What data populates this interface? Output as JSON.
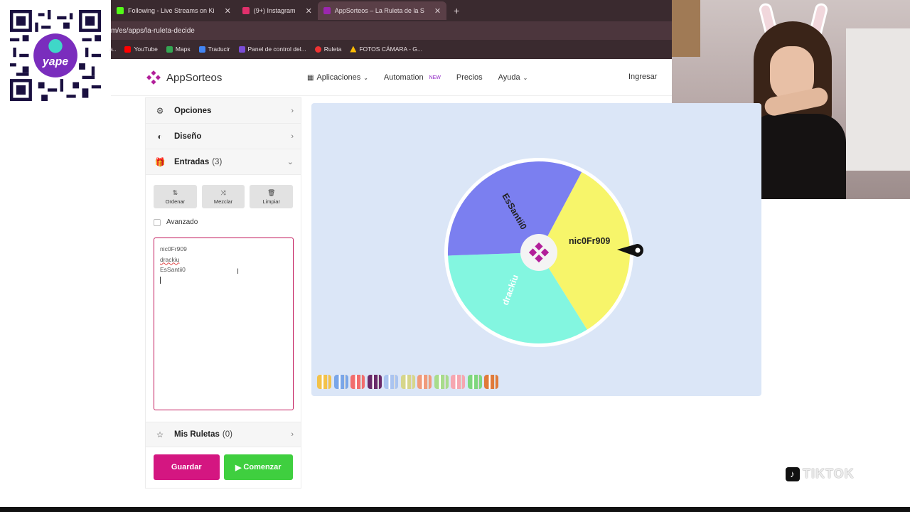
{
  "browser": {
    "tabs": [
      {
        "label": "Following - Live Streams on Ki",
        "color": "#53fc18",
        "active": false
      },
      {
        "label": "(9+) Instagram",
        "color": "#e1306c",
        "active": false
      },
      {
        "label": "AppSorteos – La Ruleta de la S",
        "color": "#9c27b0",
        "active": true
      }
    ],
    "new_tab": "+",
    "url": "m/es/apps/la-ruleta-decide",
    "bookmarks": [
      {
        "label": "",
        "color": "#666"
      },
      {
        "label": "YouTube",
        "color": "#ff0000"
      },
      {
        "label": "Maps",
        "color": "#34a853"
      },
      {
        "label": "Traducir",
        "color": "#4285f4"
      },
      {
        "label": "Panel de control del...",
        "color": "#7b4dd6"
      },
      {
        "label": "Ruleta",
        "color": "#e33"
      },
      {
        "label": "FOTOS CÁMARA - G...",
        "color": "#fbbc04"
      }
    ]
  },
  "header": {
    "brand": "AppSorteos",
    "nav": [
      {
        "label": "Aplicaciones",
        "icon": "grid-icon",
        "dropdown": true
      },
      {
        "label": "Automation",
        "badge": "NEW"
      },
      {
        "label": "Precios"
      },
      {
        "label": "Ayuda",
        "dropdown": true
      }
    ],
    "login": "Ingresar"
  },
  "panel": {
    "options": {
      "label": "Opciones"
    },
    "design": {
      "label": "Diseño"
    },
    "entries": {
      "label": "Entradas",
      "count": "(3)"
    },
    "tools": [
      {
        "label": "Ordenar",
        "glyph": "⇅"
      },
      {
        "label": "Mezclar",
        "glyph": "⤨"
      },
      {
        "label": "Limpiar",
        "glyph": "🗑"
      }
    ],
    "advanced": "Avanzado",
    "entry_lines": [
      "nic0Fr909",
      "drackiu",
      "EsSantii0"
    ],
    "my_wheels": {
      "label": "Mis Ruletas",
      "count": "(0)"
    },
    "save_label": "Guardar",
    "start_label": "Comenzar"
  },
  "wheel": {
    "segments": [
      {
        "label": "EsSantii0",
        "color": "#f7f56a"
      },
      {
        "label": "nic0Fr909",
        "color": "#83f6e0"
      },
      {
        "label": "drackiu",
        "color": "#7b7ff0"
      }
    ],
    "pointer_label": "nic0Fr909",
    "palette": [
      "#f3c24a",
      "#7aa6e8",
      "#f26d6d",
      "#6a2a6a",
      "#aac4f0",
      "#d6d68a",
      "#f09a7a",
      "#a8dc8c",
      "#f6a6b0",
      "#7ed77e",
      "#e07a3a"
    ]
  },
  "watermark": {
    "tiktok": "TIKTOK"
  }
}
